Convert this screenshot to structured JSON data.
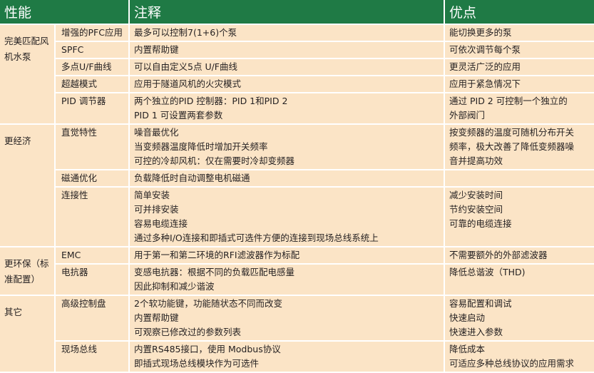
{
  "header": {
    "col1": "性能",
    "col2": "注释",
    "col3": "优点"
  },
  "groups": [
    {
      "category": "完美匹配风机水泵",
      "rows": [
        {
          "feature": "增强的PFC应用",
          "notes": [
            "最多可以控制7(1+6)个泵"
          ],
          "benefits": [
            "能切换更多的泵"
          ]
        },
        {
          "feature": "SPFC",
          "notes": [
            "内置帮助键"
          ],
          "benefits": [
            "可依次调节每个泵"
          ]
        },
        {
          "feature": "多点U/F曲线",
          "notes": [
            "可以自由定义5点  U/F曲线"
          ],
          "benefits": [
            "更灵活广泛的应用"
          ]
        },
        {
          "feature": "超越模式",
          "notes": [
            "应用于隧道风机的火灾模式"
          ],
          "benefits": [
            "应用于紧急情况下"
          ]
        },
        {
          "feature": "PID 调节器",
          "notes": [
            "两个独立的PID 控制器：PID 1和PID 2",
            "PID 1 可设置两套参数"
          ],
          "benefits": [
            "通过  PID 2 可控制一个独立的",
            "外部阀门"
          ]
        }
      ]
    },
    {
      "category": "更经济",
      "rows": [
        {
          "feature": "直觉特性",
          "notes": [
            "噪音最优化",
            "当变频器温度降低时增加开关频率",
            "可控的冷却风机：仅在需要时冷却变频器"
          ],
          "benefits": [
            "按变频器的温度可随机分布开关",
            "频率，极大改善了降低变频器噪",
            "音并提高功效"
          ]
        },
        {
          "feature": "磁通优化",
          "notes": [
            "负载降低时自动调整电机磁通"
          ],
          "benefits": []
        },
        {
          "feature": "连接性",
          "notes": [
            "简单安装",
            "可并排安装",
            "容易电缆连接",
            "通过多种I/O连接和即插式可选件方便的连接到现场总线系统上"
          ],
          "benefits": [
            "减少安装时间",
            "节约安装空间",
            "可靠的电缆连接"
          ]
        }
      ]
    },
    {
      "category": "更环保（标准配置）",
      "rows": [
        {
          "feature": "EMC",
          "notes": [
            "用于第一和第二环境的RFI滤波器作为标配"
          ],
          "benefits": [
            "不需要额外的外部滤波器"
          ]
        },
        {
          "feature": "电抗器",
          "notes": [
            "变感电抗器：根据不同的负载匹配电感量",
            "因此抑制和减少谐波"
          ],
          "benefits": [
            "降低总谐波（THD)"
          ]
        }
      ]
    },
    {
      "category": "其它",
      "rows": [
        {
          "feature": "高级控制盘",
          "notes": [
            "2个软功能键，功能随状态不同而改变",
            "内置帮助键",
            "可观察已修改过的参数列表"
          ],
          "benefits": [
            "容易配置和调试",
            "快速启动",
            "快速进入参数"
          ]
        },
        {
          "feature": "现场总线",
          "notes": [
            "内置RS485接口，使用 Modbus协议",
            "即插式现场总线模块作为可选件"
          ],
          "benefits": [
            "降低成本",
            "可适应多种总线协议的应用需求"
          ]
        }
      ]
    }
  ]
}
